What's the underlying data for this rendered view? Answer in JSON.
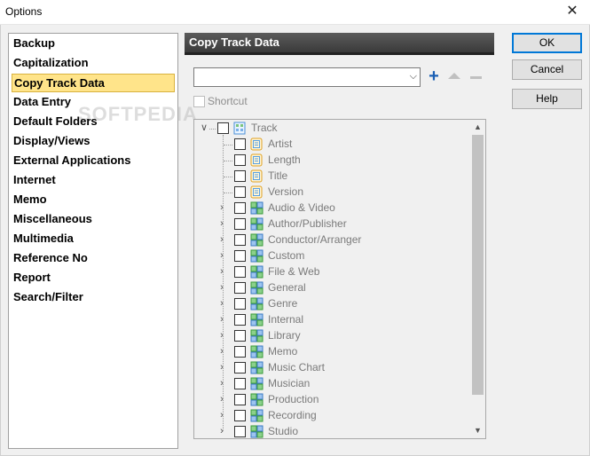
{
  "window": {
    "title": "Options"
  },
  "categories": [
    {
      "label": "Backup"
    },
    {
      "label": "Capitalization"
    },
    {
      "label": "Copy Track Data",
      "selected": true
    },
    {
      "label": "Data Entry"
    },
    {
      "label": "Default Folders"
    },
    {
      "label": "Display/Views"
    },
    {
      "label": "External Applications"
    },
    {
      "label": "Internet"
    },
    {
      "label": "Memo"
    },
    {
      "label": "Miscellaneous"
    },
    {
      "label": "Multimedia"
    },
    {
      "label": "Reference No"
    },
    {
      "label": "Report"
    },
    {
      "label": "Search/Filter"
    }
  ],
  "watermark": "SOFTPEDIA",
  "panel": {
    "title": "Copy Track Data",
    "preset_combo": {
      "value": ""
    },
    "shortcut_label": "Shortcut"
  },
  "tree": {
    "root": {
      "label": "Track",
      "expanded": true,
      "checked": false
    },
    "children": [
      {
        "label": "Artist",
        "type": "field"
      },
      {
        "label": "Length",
        "type": "field"
      },
      {
        "label": "Title",
        "type": "field"
      },
      {
        "label": "Version",
        "type": "field"
      },
      {
        "label": "Audio & Video",
        "type": "group"
      },
      {
        "label": "Author/Publisher",
        "type": "group"
      },
      {
        "label": "Conductor/Arranger",
        "type": "group"
      },
      {
        "label": "Custom",
        "type": "group"
      },
      {
        "label": "File & Web",
        "type": "group"
      },
      {
        "label": "General",
        "type": "group"
      },
      {
        "label": "Genre",
        "type": "group"
      },
      {
        "label": "Internal",
        "type": "group"
      },
      {
        "label": "Library",
        "type": "group"
      },
      {
        "label": "Memo",
        "type": "group"
      },
      {
        "label": "Music Chart",
        "type": "group"
      },
      {
        "label": "Musician",
        "type": "group"
      },
      {
        "label": "Production",
        "type": "group"
      },
      {
        "label": "Recording",
        "type": "group"
      },
      {
        "label": "Studio",
        "type": "group"
      }
    ]
  },
  "buttons": {
    "ok": "OK",
    "cancel": "Cancel",
    "help": "Help"
  },
  "colors": {
    "selection_bg": "#ffe48a",
    "header_bg": "#4a4a4a",
    "accent_plus": "#1a5fb4"
  }
}
